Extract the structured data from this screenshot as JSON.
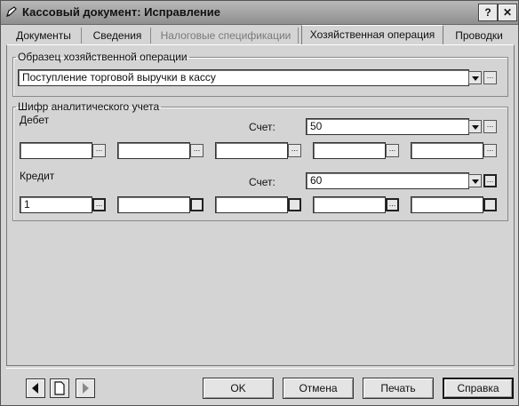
{
  "window": {
    "title": "Кассовый документ: Исправление",
    "help_btn": "?",
    "close_btn": "✕"
  },
  "tabs": [
    {
      "label": "Документы"
    },
    {
      "label": "Сведения"
    },
    {
      "label": "Налоговые спецификации"
    },
    {
      "label": "Хозяйственная операция"
    },
    {
      "label": "Проводки"
    }
  ],
  "template": {
    "legend": "Образец хозяйственной операции",
    "value": "Поступление торговой выручки в кассу"
  },
  "analytics": {
    "legend": "Шифр аналитического учета",
    "debit": {
      "label": "Дебет",
      "account_label": "Счет:",
      "account_value": "50",
      "fields": [
        "",
        "",
        "",
        "",
        ""
      ]
    },
    "credit": {
      "label": "Кредит",
      "account_label": "Счет:",
      "account_value": "60",
      "fields": [
        "1",
        "",
        "",
        "",
        ""
      ]
    }
  },
  "buttons": {
    "ok": "OK",
    "cancel": "Отмена",
    "print": "Печать",
    "help": "Справка"
  },
  "dots_glyph": "..."
}
